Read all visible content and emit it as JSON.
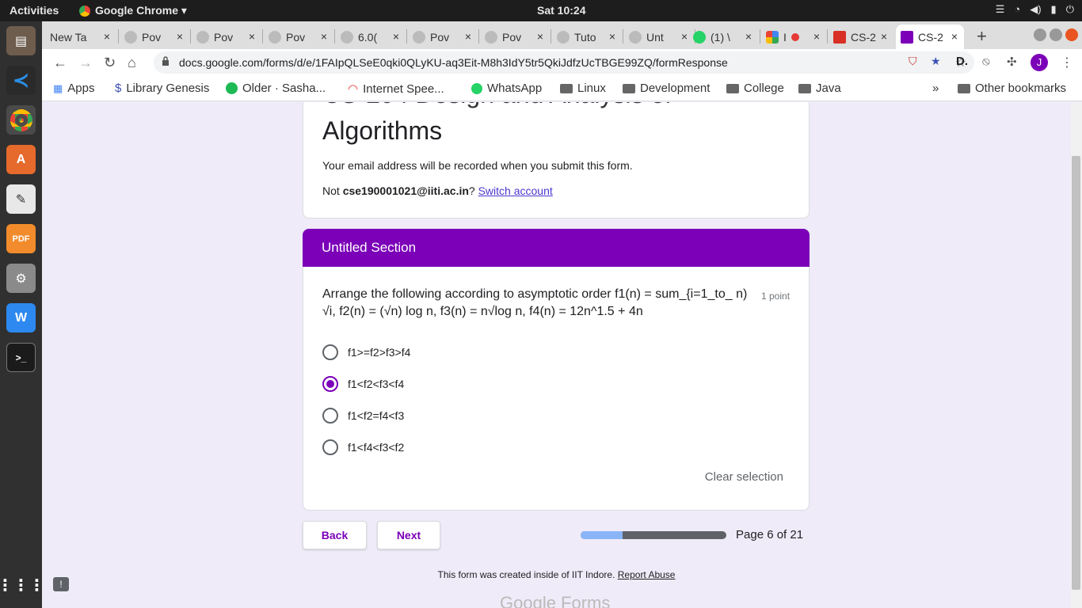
{
  "system": {
    "activities": "Activities",
    "app_menu": "Google Chrome ▾",
    "clock": "Sat 10:24"
  },
  "tabs": [
    {
      "label": "New Ta",
      "color": "#999"
    },
    {
      "label": "Pov",
      "color": "#999"
    },
    {
      "label": "Pov",
      "color": "#999"
    },
    {
      "label": "Pov",
      "color": "#999"
    },
    {
      "label": "6.0(",
      "color": "#999"
    },
    {
      "label": "Pov",
      "color": "#999"
    },
    {
      "label": "Pov",
      "color": "#999"
    },
    {
      "label": "Tuto",
      "color": "#999"
    },
    {
      "label": "Unt",
      "color": "#999"
    },
    {
      "label": "(1) \\",
      "color": "#25d366"
    },
    {
      "label": "I",
      "color": "#e53935"
    },
    {
      "label": "CS-2",
      "color": "#d93025"
    },
    {
      "label": "CS-2",
      "color": "#7b00b8"
    }
  ],
  "address": "docs.google.com/forms/d/e/1FAIpQLSeE0qki0QLyKU-aq3Eit-M8h3IdY5tr5QkiJdfzUcTBGE99ZQ/formResponse",
  "bookmarks": [
    "Apps",
    "Library Genesis",
    "Older · Sasha...",
    "Internet Spee...",
    "WhatsApp",
    "Linux",
    "Development",
    "College",
    "Java"
  ],
  "other_bookmarks": "Other bookmarks",
  "more_bookmarks": "»",
  "form": {
    "title": "Algorithms",
    "email_note": "Your email address will be recorded when you submit this form.",
    "not_prefix": "Not ",
    "account": "cse190001021@iiti.ac.in",
    "question_mark": "?",
    "switch": "Switch account",
    "section": "Untitled Section",
    "question": "Arrange the following according to asymptotic order f1(n) = sum_{i=1_to_ n) √i, f2(n) = (√n) log n, f3(n) = n√log n, f4(n) = 12n^1.5 + 4n",
    "points": "1 point",
    "options": [
      "f1>=f2>f3>f4",
      "f1<f2<f3<f4",
      "f1<f2=f4<f3",
      "f1<f4<f3<f2"
    ],
    "selected": 1,
    "clear": "Clear selection",
    "back": "Back",
    "next": "Next",
    "progress": 0.2857,
    "page": "Page 6 of 21",
    "footer": "This form was created inside of IIT Indore.",
    "report": "Report Abuse"
  },
  "accent": "#7b00b8"
}
